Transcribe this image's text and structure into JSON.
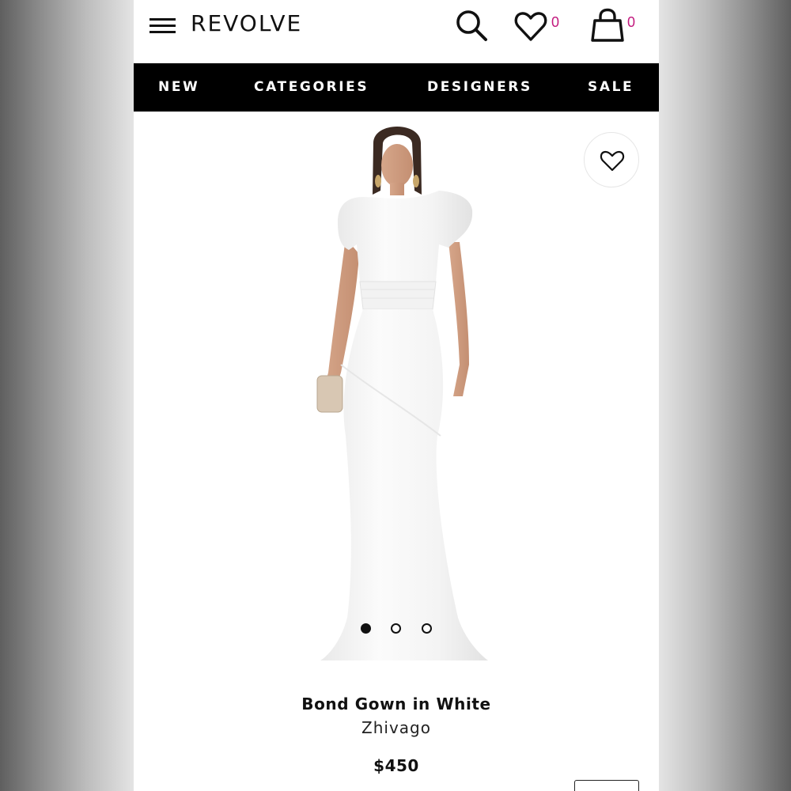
{
  "header": {
    "logo": "REVOLVE",
    "wishlist_count": "0",
    "bag_count": "0"
  },
  "nav": {
    "items": [
      {
        "label": "NEW"
      },
      {
        "label": "CATEGORIES"
      },
      {
        "label": "DESIGNERS"
      },
      {
        "label": "SALE"
      }
    ]
  },
  "product": {
    "name": "Bond Gown in White",
    "designer": "Zhivago",
    "price": "$450",
    "image_count": 3,
    "active_image": 1
  },
  "icons": [
    "menu-icon",
    "search-icon",
    "heart-icon",
    "bag-icon"
  ],
  "colors": {
    "accent_count": "#c2187d",
    "nav_bg": "#000000",
    "text": "#111111"
  }
}
